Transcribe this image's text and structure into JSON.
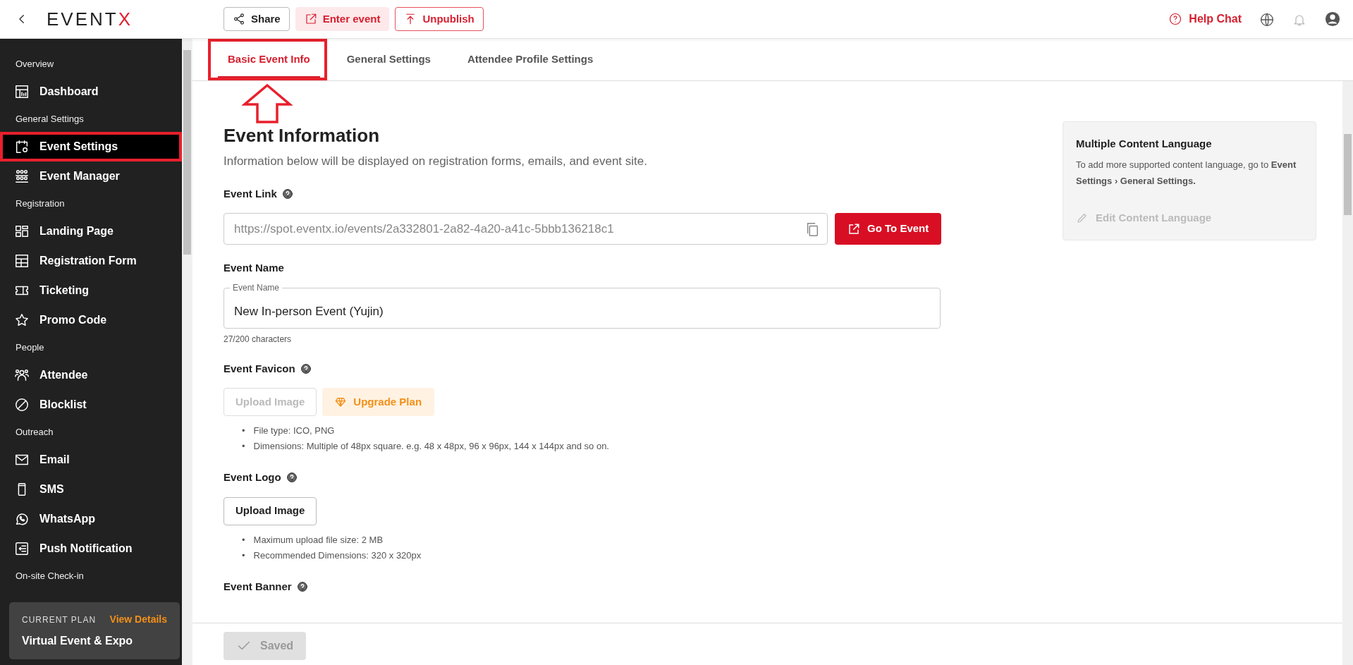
{
  "topbar": {
    "logo": {
      "text": "EVENT",
      "accent": "X"
    },
    "actions": [
      {
        "label": "Share",
        "kind": "outline"
      },
      {
        "label": "Enter event",
        "kind": "tinted"
      },
      {
        "label": "Unpublish",
        "kind": "danger"
      }
    ],
    "help": "Help Chat"
  },
  "sidebar": {
    "sections": [
      {
        "title": "Overview",
        "items": [
          {
            "label": "Dashboard",
            "selected": false,
            "highlighted": false
          }
        ]
      },
      {
        "title": "General Settings",
        "items": [
          {
            "label": "Event Settings",
            "selected": true,
            "highlighted": true
          },
          {
            "label": "Event Manager",
            "selected": false,
            "highlighted": false
          }
        ]
      },
      {
        "title": "Registration",
        "items": [
          {
            "label": "Landing Page",
            "selected": false,
            "highlighted": false
          },
          {
            "label": "Registration Form",
            "selected": false,
            "highlighted": false
          },
          {
            "label": "Ticketing",
            "selected": false,
            "highlighted": false
          },
          {
            "label": "Promo Code",
            "selected": false,
            "highlighted": false
          }
        ]
      },
      {
        "title": "People",
        "items": [
          {
            "label": "Attendee",
            "selected": false,
            "highlighted": false
          },
          {
            "label": "Blocklist",
            "selected": false,
            "highlighted": false
          }
        ]
      },
      {
        "title": "Outreach",
        "items": [
          {
            "label": "Email",
            "selected": false,
            "highlighted": false
          },
          {
            "label": "SMS",
            "selected": false,
            "highlighted": false
          },
          {
            "label": "WhatsApp",
            "selected": false,
            "highlighted": false
          },
          {
            "label": "Push Notification",
            "selected": false,
            "highlighted": false
          }
        ]
      },
      {
        "title": "On-site Check-in"
      }
    ],
    "plan": {
      "caption": "CURRENT PLAN",
      "link": "View Details",
      "name": "Virtual Event & Expo"
    }
  },
  "tabs": [
    {
      "label": "Basic Event Info",
      "selected": true,
      "highlighted": true,
      "arrow": true
    },
    {
      "label": "General Settings",
      "selected": false,
      "highlighted": false,
      "arrow": false
    },
    {
      "label": "Attendee Profile Settings",
      "selected": false,
      "highlighted": false,
      "arrow": false
    }
  ],
  "content": {
    "heading": "Event Information",
    "subtitle": "Information below will be displayed on registration forms, emails, and event site.",
    "link": {
      "label": "Event Link",
      "value": "https://spot.eventx.io/events/2a332801-2a82-4a20-a41c-5bbb136218c1",
      "button": "Go To Event"
    },
    "name": {
      "label": "Event Name",
      "field_label": "Event Name",
      "value": "New In-person Event (Yujin)",
      "counter": "27/200 characters"
    },
    "favicon": {
      "label": "Event Favicon",
      "upload": {
        "label": "Upload Image",
        "disabled": true
      },
      "upgrade": "Upgrade Plan",
      "notes": [
        {
          "bullet": "•",
          "text": "File type: ICO, PNG"
        },
        {
          "bullet": "•",
          "text": "Dimensions: Multiple of 48px square. e.g. 48 x 48px, 96 x 96px, 144 x 144px and so on."
        }
      ]
    },
    "logo": {
      "label": "Event Logo",
      "upload": {
        "label": "Upload Image",
        "disabled": false
      },
      "notes": [
        {
          "bullet": "•",
          "text": "Maximum upload file size: 2 MB"
        },
        {
          "bullet": "•",
          "text": "Recommended Dimensions: 320 x 320px"
        }
      ]
    },
    "banner": {
      "label": "Event Banner"
    }
  },
  "language_panel": {
    "title": "Multiple Content Language",
    "text": "To add more supported content language, go to **Event Settings › General Settings.**",
    "button": {
      "label": "Edit Content Language",
      "disabled": true
    }
  },
  "footer": {
    "save": {
      "label": "Saved",
      "disabled": true
    }
  }
}
